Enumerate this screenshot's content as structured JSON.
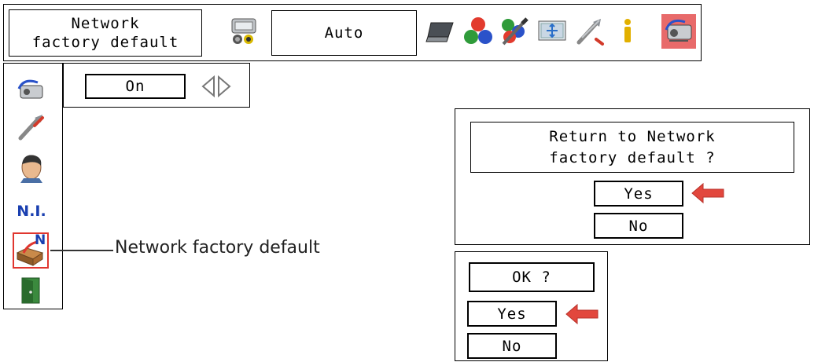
{
  "top_bar": {
    "title_line1": "Network",
    "title_line2": "factory default",
    "mode_value": "Auto",
    "icons": [
      "input-source-icon",
      "laptop-icon",
      "color-balls-icon",
      "image-adjust-icon",
      "screen-icon",
      "setting-wrench-icon",
      "info-icon",
      "network-projector-icon"
    ],
    "active_icon": "network-projector-icon",
    "active_color": "#e86a6a"
  },
  "side_menu": {
    "items": [
      "network-projector-icon",
      "setting-wrench-icon",
      "user-head-icon",
      "ni-icon",
      "network-factory-default-icon",
      "exit-door-icon"
    ],
    "ni_label": "N.I.",
    "n_badge": "N",
    "selected_item": "network-factory-default-icon",
    "selected_border_color": "#e0362f"
  },
  "submenu": {
    "value": "On"
  },
  "callout_label": "Network factory default",
  "confirm_dialog": {
    "question_line1": "Return to Network",
    "question_line2": "factory default ?",
    "yes": "Yes",
    "no": "No"
  },
  "ok_dialog": {
    "question": "OK ?",
    "yes": "Yes",
    "no": "No"
  },
  "pointer_color": "#e2473d"
}
